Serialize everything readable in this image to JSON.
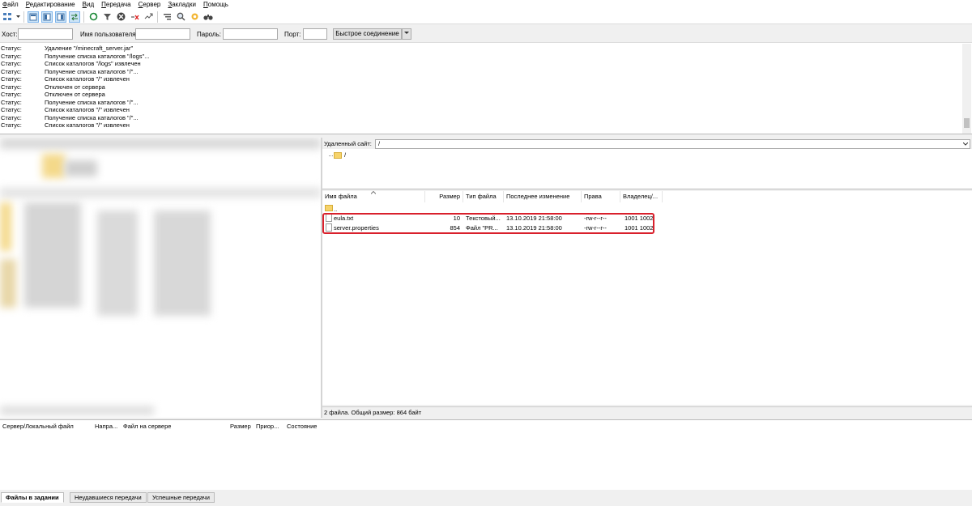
{
  "menu": [
    {
      "first": "Ф",
      "rest": "айл"
    },
    {
      "first": "Р",
      "rest": "едактирование"
    },
    {
      "first": "В",
      "rest": "ид"
    },
    {
      "first": "П",
      "rest": "ередача"
    },
    {
      "first": "С",
      "rest": "ервер"
    },
    {
      "first": "З",
      "rest": "акладки"
    },
    {
      "first": "П",
      "rest": "омощь"
    }
  ],
  "quickconnect": {
    "host_label": "Хост:",
    "user_label": "Имя пользователя:",
    "pass_label": "Пароль:",
    "port_label": "Порт:",
    "host_value": "",
    "user_value": "",
    "pass_value": "",
    "port_value": "",
    "button_label": "Быстрое соединение",
    "dropdown_icon": "chevron-down-icon"
  },
  "log": [
    {
      "k": "Статус:",
      "v": "Удаление \"/minecraft_server.jar\""
    },
    {
      "k": "Статус:",
      "v": "Получение списка каталогов \"/logs\"..."
    },
    {
      "k": "Статус:",
      "v": "Список каталогов \"/logs\" извлечен"
    },
    {
      "k": "Статус:",
      "v": "Получение списка каталогов \"/\"..."
    },
    {
      "k": "Статус:",
      "v": "Список каталогов \"/\" извлечен"
    },
    {
      "k": "Статус:",
      "v": "Отключен от сервера"
    },
    {
      "k": "Статус:",
      "v": "Отключен от сервера"
    },
    {
      "k": "Статус:",
      "v": "Получение списка каталогов \"/\"..."
    },
    {
      "k": "Статус:",
      "v": "Список каталогов \"/\" извлечен"
    },
    {
      "k": "Статус:",
      "v": "Получение списка каталогов \"/\"..."
    },
    {
      "k": "Статус:",
      "v": "Список каталогов \"/\" извлечен"
    }
  ],
  "remote": {
    "site_label": "Удаленный сайт:",
    "path": "/",
    "tree_root": "/",
    "columns": [
      "Имя файла",
      "Размер",
      "Тип файла",
      "Последнее изменение",
      "Права",
      "Владелец/..."
    ],
    "parent_entry": "..",
    "files": [
      {
        "name": "eula.txt",
        "size": "10",
        "type": "Текстовый...",
        "modified": "13.10.2019 21:58:00",
        "perms": "-rw-r--r--",
        "owner": "1001 1002"
      },
      {
        "name": "server.properties",
        "size": "854",
        "type": "Файл \"PR...",
        "modified": "13.10.2019 21:58:00",
        "perms": "-rw-r--r--",
        "owner": "1001 1002"
      }
    ],
    "status": "2 файла. Общий размер: 864 байт"
  },
  "queue": {
    "columns": [
      "Сервер/Локальный файл",
      "Напра...",
      "Файл на сервере",
      "Размер",
      "Приор...",
      "Состояние"
    ]
  },
  "tabs": [
    "Файлы в задании",
    "Неудавшиеся передачи",
    "Успешные передачи"
  ],
  "colors": {
    "highlight": "#d9202c",
    "folder": "#f6d36b",
    "selection": "#cce4f7"
  }
}
